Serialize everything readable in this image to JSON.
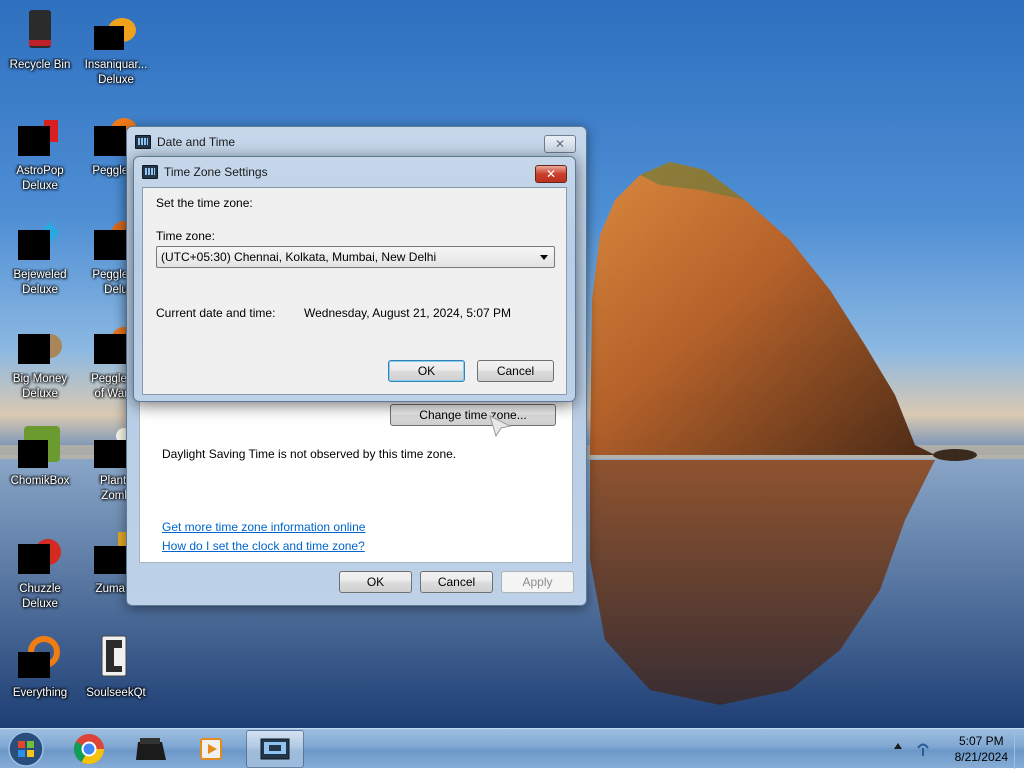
{
  "desktop": {
    "icons": [
      {
        "label": "Recycle Bin",
        "icon": "recycle-bin-icon"
      },
      {
        "label": "Insaniquarium Deluxe",
        "line1": "Insaniquar...",
        "line2": "Deluxe",
        "icon": "fish-game-icon"
      },
      {
        "label": "AstroPop Deluxe",
        "line1": "AstroPop",
        "line2": "Deluxe",
        "icon": "astropop-icon"
      },
      {
        "label": "Peggle Deluxe",
        "line1": "Peggle D",
        "icon": "peggle-icon"
      },
      {
        "label": "Bejeweled Deluxe",
        "line1": "Bejeweled",
        "line2": "Deluxe",
        "icon": "bejeweled-icon"
      },
      {
        "label": "Peggle Nights Deluxe",
        "line1": "Peggle N",
        "line2": "Delu",
        "icon": "peggle-nights-icon"
      },
      {
        "label": "Big Money Deluxe",
        "line1": "Big Money",
        "line2": "Deluxe",
        "icon": "money-bag-icon"
      },
      {
        "label": "Peggle World of Warcraft",
        "line1": "Peggle W",
        "line2": "of Warcr",
        "icon": "peggle-wow-icon"
      },
      {
        "label": "ChomikBox",
        "icon": "chomikbox-icon"
      },
      {
        "label": "Plants vs. Zombies",
        "line1": "Plants",
        "line2": "Zomb",
        "icon": "plants-icon"
      },
      {
        "label": "Chuzzle Deluxe",
        "line1": "Chuzzle",
        "line2": "Deluxe",
        "icon": "chuzzle-icon"
      },
      {
        "label": "Zuma Deluxe",
        "line1": "Zuma D",
        "icon": "zuma-icon"
      },
      {
        "label": "Everything",
        "icon": "everything-search-icon"
      },
      {
        "label": "SoulseekQt",
        "icon": "soulseek-icon"
      }
    ]
  },
  "date_time_dialog": {
    "title": "Date and Time",
    "change_time_zone_button": "Change time zone...",
    "dst_text": "Daylight Saving Time is not observed by this time zone.",
    "link_more_info": "Get more time zone information online",
    "link_how_to": "How do I set the clock and time zone?",
    "ok_label": "OK",
    "cancel_label": "Cancel",
    "apply_label": "Apply"
  },
  "time_zone_dialog": {
    "title": "Time Zone Settings",
    "heading": "Set the time zone:",
    "time_zone_label": "Time zone:",
    "time_zone_value": "(UTC+05:30) Chennai, Kolkata, Mumbai, New Delhi",
    "current_label": "Current date and time:",
    "current_value": "Wednesday, August 21, 2024, 5:07 PM",
    "ok_label": "OK",
    "cancel_label": "Cancel"
  },
  "taskbar": {
    "items": [
      "start-orb",
      "chrome",
      "app-dark",
      "media-player",
      "date-time-control-panel"
    ],
    "clock_time": "5:07 PM",
    "clock_date": "8/21/2024"
  },
  "colors": {
    "link": "#0066cc",
    "close_active": "#c9412d",
    "taskbar": "#7fa7d2"
  }
}
